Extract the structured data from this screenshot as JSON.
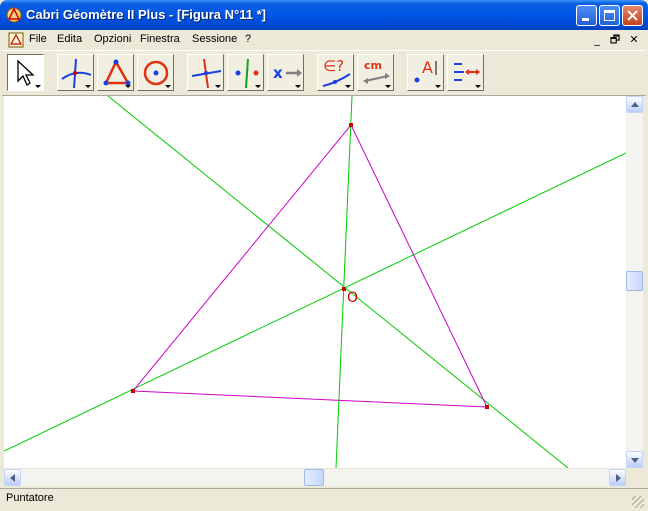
{
  "window": {
    "title": "Cabri Géomètre II Plus - [Figura N°11 *]",
    "app_icon": "cabri-app-icon",
    "controls": [
      "minimize-icon",
      "maximize-icon",
      "close-icon"
    ]
  },
  "menu": {
    "items": [
      {
        "label": "File"
      },
      {
        "label": "Edita"
      },
      {
        "label": "Opzioni"
      },
      {
        "label": "Finestra"
      },
      {
        "label": "Sessione"
      },
      {
        "label": "?"
      }
    ],
    "doc_controls": [
      "_",
      "🗗",
      "✕"
    ]
  },
  "toolbar": {
    "tools": [
      {
        "name": "pointer-tool"
      },
      {
        "name": "lines-tool"
      },
      {
        "name": "polygons-tool"
      },
      {
        "name": "curves-tool"
      },
      {
        "name": "constructions-tool"
      },
      {
        "name": "transformations-tool"
      },
      {
        "name": "macro-tool"
      },
      {
        "name": "properties-tool",
        "label": "∈?"
      },
      {
        "name": "measure-tool",
        "label": "cm"
      },
      {
        "name": "text-tool",
        "label": "A"
      },
      {
        "name": "attributes-tool"
      }
    ]
  },
  "figure": {
    "point_label": "O",
    "colors": {
      "triangle": "#cc00cc",
      "lines": "#00cc00",
      "points": "#cc0000",
      "label": "#cc0000"
    }
  },
  "status": {
    "text": "Puntatore"
  }
}
